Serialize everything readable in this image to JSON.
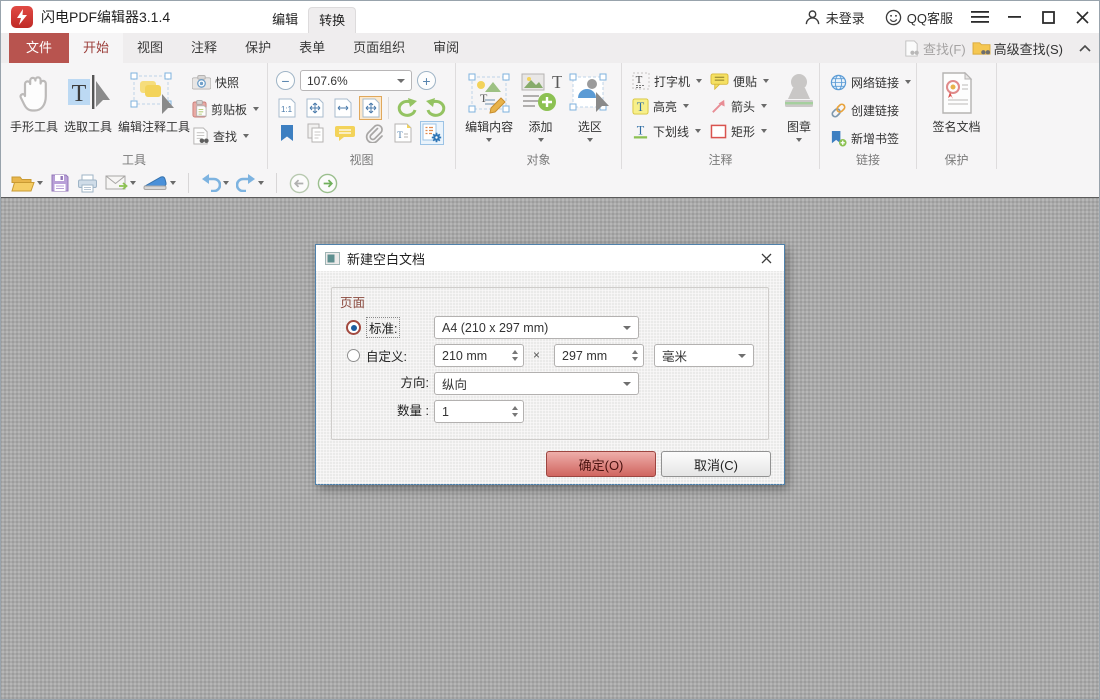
{
  "titlebar": {
    "app_title": "闪电PDF编辑器3.1.4",
    "mode_tabs": [
      {
        "label": "编辑"
      },
      {
        "label": "转换"
      }
    ],
    "login_label": "未登录",
    "qq_label": "QQ客服"
  },
  "ribbon_tabs": {
    "file": "文件",
    "items": [
      {
        "label": "开始"
      },
      {
        "label": "视图"
      },
      {
        "label": "注释"
      },
      {
        "label": "保护"
      },
      {
        "label": "表单"
      },
      {
        "label": "页面组织"
      },
      {
        "label": "审阅"
      }
    ],
    "find_label": "查找(F)",
    "advanced_find_label": "高级查找(S)"
  },
  "ribbon": {
    "tools": {
      "label": "工具",
      "hand": "手形工具",
      "select": "选取工具",
      "edit_annot": "编辑注释工具",
      "snapshot": "快照",
      "clipboard": "剪贴板",
      "find": "查找"
    },
    "view": {
      "label": "视图",
      "zoom_value": "107.6%",
      "icons": [
        "actual-size",
        "fit-page",
        "fit-width",
        "fit-visible",
        "rotate-left",
        "rotate-right",
        "bookmark-panel",
        "copy-pages",
        "comments-panel",
        "attachment",
        "text-properties",
        "settings"
      ]
    },
    "object": {
      "label": "对象",
      "edit_content": "编辑内容",
      "add": "添加",
      "selection": "选区"
    },
    "comment": {
      "label": "注释",
      "typewriter": "打字机",
      "sticky": "便贴",
      "highlight": "高亮",
      "arrow": "箭头",
      "underline": "下划线",
      "rect": "矩形",
      "stamp": "图章"
    },
    "link": {
      "label": "链接",
      "web_link": "网络链接",
      "create_link": "创建链接",
      "add_bookmark": "新增书签"
    },
    "protect": {
      "label": "保护",
      "sign_doc": "签名文档"
    }
  },
  "quickbar": {
    "icons": [
      "open-file",
      "save",
      "print",
      "email",
      "scanner",
      "undo",
      "redo",
      "previous-view",
      "next-view"
    ]
  },
  "dialog": {
    "title": "新建空白文档",
    "page_group": "页面",
    "standard_label": "标准:",
    "standard_value": "A4 (210 x 297 mm)",
    "custom_label": "自定义:",
    "width_value": "210 mm",
    "times": "×",
    "height_value": "297 mm",
    "unit_value": "毫米",
    "orientation_label": "方向:",
    "orientation_value": "纵向",
    "quantity_label": "数量 :",
    "quantity_value": "1",
    "ok_label": "确定(O)",
    "cancel_label": "取消(C)"
  }
}
